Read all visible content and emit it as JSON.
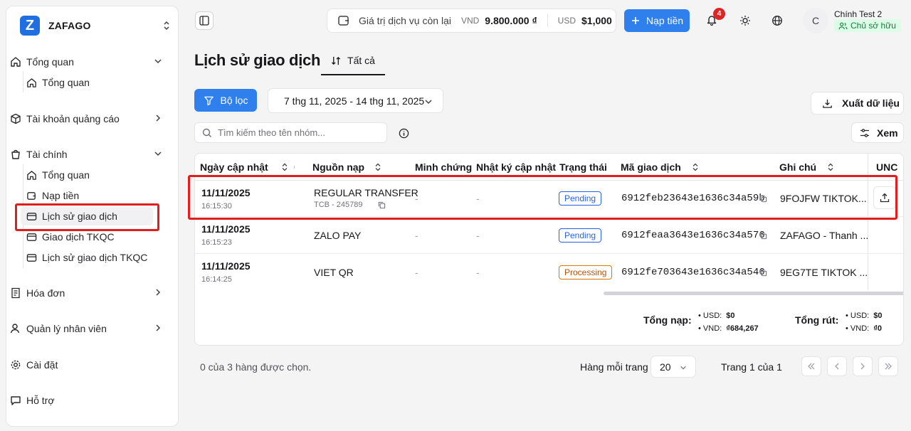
{
  "brand": {
    "name": "ZAFAGO",
    "logo_letter": "Z"
  },
  "sidebar": {
    "sections": [
      {
        "label": "Tổng quan",
        "icon": "home-icon"
      },
      {
        "label": "Tài khoản quảng cáo",
        "icon": "box-icon"
      },
      {
        "label": "Tài chính",
        "icon": "bag-icon"
      },
      {
        "label": "Hóa đơn",
        "icon": "invoice-icon"
      },
      {
        "label": "Quản lý nhân viên",
        "icon": "user-icon"
      },
      {
        "label": "Cài đặt",
        "icon": "gear-icon"
      },
      {
        "label": "Hỗ trợ",
        "icon": "chat-icon"
      }
    ],
    "overview_sub": [
      "Tổng quan"
    ],
    "finance_sub": [
      "Tổng quan",
      "Nạp tiền",
      "Lịch sử giao dịch",
      "Giao dịch TKQC",
      "Lịch sử giao dịch TKQC"
    ]
  },
  "header": {
    "balance_label": "Giá trị dịch vụ còn lại",
    "vnd_label": "VND",
    "vnd_value": "9.800.000 ₫",
    "usd_label": "USD",
    "usd_value": "$1,000",
    "topup_button": "Nạp tiền",
    "notification_count": "4",
    "user": {
      "initial": "C",
      "name": "Chính Test 2",
      "role": "Chủ sở hữu"
    }
  },
  "page": {
    "title": "Lịch sử giao dịch",
    "tab": "Tất cả"
  },
  "toolbar": {
    "filter_button": "Bộ lọc",
    "date_range": "7 thg 11, 2025 - 14 thg 11, 2025",
    "export_button": "Xuất dữ liệu",
    "search_placeholder": "Tìm kiếm theo tên nhóm...",
    "view_button": "Xem"
  },
  "table": {
    "headers": [
      "Ngày cập nhật",
      "Nguồn nạp",
      "Minh chứng",
      "Nhật ký cập nhật",
      "Trạng thái",
      "Mã giao dịch",
      "Ghi chú",
      "UNC"
    ],
    "rows": [
      {
        "date": "11/11/2025",
        "time": "16:15:30",
        "source": "REGULAR TRANSFER",
        "source_sub": "TCB - 245789",
        "proof": "-",
        "log": "-",
        "status": "Pending",
        "txn": "6912feb23643e1636c34a59b",
        "note": "9FOJFW TIKTOK..."
      },
      {
        "date": "11/11/2025",
        "time": "16:15:23",
        "source": "ZALO PAY",
        "source_sub": "",
        "proof": "-",
        "log": "-",
        "status": "Pending",
        "txn": "6912feaa3643e1636c34a576",
        "note": "ZAFAGO - Thanh ..."
      },
      {
        "date": "11/11/2025",
        "time": "16:14:25",
        "source": "VIET QR",
        "source_sub": "",
        "proof": "-",
        "log": "-",
        "status": "Processing",
        "txn": "6912fe703643e1636c34a546",
        "note": "9EG7TE TIKTOK ..."
      }
    ],
    "totals": {
      "deposit_label": "Tổng nạp:",
      "deposit_usd_label": "USD:",
      "deposit_usd": "$0",
      "deposit_vnd_label": "VND:",
      "deposit_vnd": "₫684,267",
      "withdraw_label": "Tổng rút:",
      "withdraw_usd_label": "USD:",
      "withdraw_usd": "$0",
      "withdraw_vnd_label": "VND:",
      "withdraw_vnd": "₫0"
    }
  },
  "footer": {
    "selected_text": "0 của 3 hàng được chọn.",
    "rows_per_page_label": "Hàng mỗi trang",
    "rows_per_page": "20",
    "page_info": "Trang 1 của 1"
  },
  "colors": {
    "accent": "#2f80ed",
    "highlight": "#e11d1d",
    "pending": "#2563eb",
    "processing": "#d97706",
    "success": "#16a34a"
  }
}
